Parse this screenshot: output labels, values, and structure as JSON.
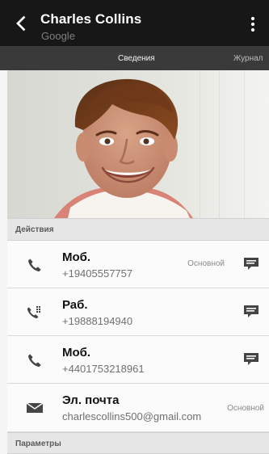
{
  "header": {
    "title": "Charles Collins",
    "subtitle": "Google"
  },
  "tabs": [
    {
      "label": "Сведения"
    },
    {
      "label": "Журнал"
    }
  ],
  "sections": {
    "actions": "Действия",
    "parameters": "Параметры"
  },
  "contacts": [
    {
      "label": "Моб.",
      "value": "+19405557757",
      "badge": "Основной"
    },
    {
      "label": "Раб.",
      "value": "+19888194940"
    },
    {
      "label": "Моб.",
      "value": "+4401753218961"
    }
  ],
  "email": {
    "label": "Эл. почта",
    "value": "charlescollins500@gmail.com",
    "badge": "Основной"
  },
  "colors": {
    "header": "#171717",
    "tabs": "#3a3a3a",
    "section": "#e6e6e6",
    "row": "#fbfbfb",
    "icon": "#444444"
  },
  "icons": {
    "back": "chevron-left-icon",
    "menu": "overflow-menu-icon",
    "phone": "phone-icon",
    "work": "work-phone-icon",
    "email": "mail-icon",
    "message": "message-icon"
  }
}
